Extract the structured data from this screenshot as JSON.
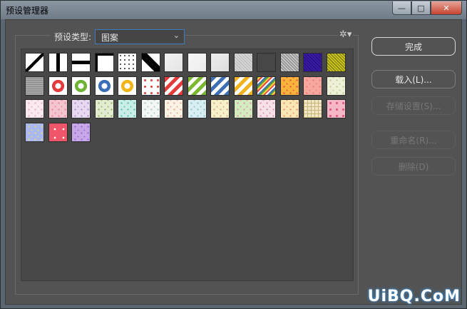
{
  "window": {
    "title": "预设管理器"
  },
  "controls": {
    "minimize": "—",
    "maximize": "□",
    "close": "✕"
  },
  "preset_type": {
    "label": "预设类型:",
    "value": "图案"
  },
  "buttons": {
    "done": "完成",
    "load": "载入(L)...",
    "save": "存储设置(S)...",
    "rename": "重命名(R)...",
    "delete": "删除(D)"
  },
  "watermark": "UiBQ.CoM",
  "swatches": [
    {
      "kind": "diag",
      "c1": "#ffffff",
      "c2": "#000000"
    },
    {
      "kind": "vbar",
      "c1": "#ffffff",
      "c2": "#000000"
    },
    {
      "kind": "hbar",
      "c1": "#ffffff",
      "c2": "#000000"
    },
    {
      "kind": "corner",
      "c1": "#ffffff",
      "c2": "#000000"
    },
    {
      "kind": "dots",
      "c1": "#ffffff",
      "c2": "#222222"
    },
    {
      "kind": "stair",
      "c1": "#ffffff",
      "c2": "#000000"
    },
    {
      "kind": "plain",
      "c1": "#f2f2f2",
      "c2": "#e4e4e4"
    },
    {
      "kind": "plain",
      "c1": "#f6f6f6",
      "c2": "#ececec"
    },
    {
      "kind": "plain",
      "c1": "#ededed",
      "c2": "#dedede"
    },
    {
      "kind": "noise",
      "c1": "#d6d6d6",
      "c2": "#b5b5b5"
    },
    {
      "kind": "concentric",
      "c1": "#ffffff",
      "c2": "#333333"
    },
    {
      "kind": "noise",
      "c1": "#9a9a9a",
      "c2": "#dddddd"
    },
    {
      "kind": "noise",
      "c1": "#3a1aa8",
      "c2": "#1f0f6a"
    },
    {
      "kind": "noise",
      "c1": "#c8c21a",
      "c2": "#6a6a10"
    },
    {
      "kind": "lines",
      "c1": "#a6a6a6",
      "c2": "#8a8a8a"
    },
    {
      "kind": "ring",
      "c1": "#e43c3c",
      "c2": "#ffffff"
    },
    {
      "kind": "ring",
      "c1": "#6fb334",
      "c2": "#ffffff"
    },
    {
      "kind": "ring",
      "c1": "#3b6fb8",
      "c2": "#ffffff"
    },
    {
      "kind": "ring",
      "c1": "#f2b418",
      "c2": "#ffffff"
    },
    {
      "kind": "dotsc",
      "c1": "#ffffff",
      "c2": "#e54848"
    },
    {
      "kind": "stripes",
      "c1": "#e63a3a",
      "c2": "#ffffff"
    },
    {
      "kind": "stripes",
      "c1": "#7ab82f",
      "c2": "#ffffff"
    },
    {
      "kind": "stripes",
      "c1": "#3d6fb5",
      "c2": "#ffffff"
    },
    {
      "kind": "stripes",
      "c1": "#f2b21a",
      "c2": "#ffffff"
    },
    {
      "kind": "rainbow",
      "c1": "#e84a4a",
      "c2": "#5aa03a"
    },
    {
      "kind": "floral",
      "c1": "#f7b33a",
      "c2": "#e84848"
    },
    {
      "kind": "floral",
      "c1": "#f6a7a0",
      "c2": "#f07a70"
    },
    {
      "kind": "floral",
      "c1": "#eef0d8",
      "c2": "#b9c98a"
    },
    {
      "kind": "floral",
      "c1": "#fbe9f0",
      "c2": "#e2a9c6"
    },
    {
      "kind": "floral",
      "c1": "#f4c4cf",
      "c2": "#e57f9d"
    },
    {
      "kind": "floral",
      "c1": "#e8d9f2",
      "c2": "#a98bc9"
    },
    {
      "kind": "floral",
      "c1": "#e3ecd0",
      "c2": "#8cad5a"
    },
    {
      "kind": "floral",
      "c1": "#c9eee8",
      "c2": "#59b9a6"
    },
    {
      "kind": "floral",
      "c1": "#f3f6f4",
      "c2": "#a6c7bb"
    },
    {
      "kind": "floral",
      "c1": "#fbf2e6",
      "c2": "#e4a48d"
    },
    {
      "kind": "floral",
      "c1": "#d8eef0",
      "c2": "#8cc0c7"
    },
    {
      "kind": "floral",
      "c1": "#f6f1c9",
      "c2": "#d7a28c"
    },
    {
      "kind": "floral",
      "c1": "#d2ecbf",
      "c2": "#e98aa9"
    },
    {
      "kind": "floral",
      "c1": "#f7e1e8",
      "c2": "#d98ab0"
    },
    {
      "kind": "floral",
      "c1": "#f9e6b3",
      "c2": "#e98f6a"
    },
    {
      "kind": "plaid",
      "c1": "#f1e6c4",
      "c2": "#c9b67a"
    },
    {
      "kind": "dotsc",
      "c1": "#f5b6c7",
      "c2": "#e05a7d"
    },
    {
      "kind": "floral",
      "c1": "#a9b8ee",
      "c2": "#e9d57a"
    },
    {
      "kind": "bigdots",
      "c1": "#f0566a",
      "c2": "#ffffff"
    },
    {
      "kind": "floral",
      "c1": "#c9a6ea",
      "c2": "#8a6bc9"
    }
  ]
}
